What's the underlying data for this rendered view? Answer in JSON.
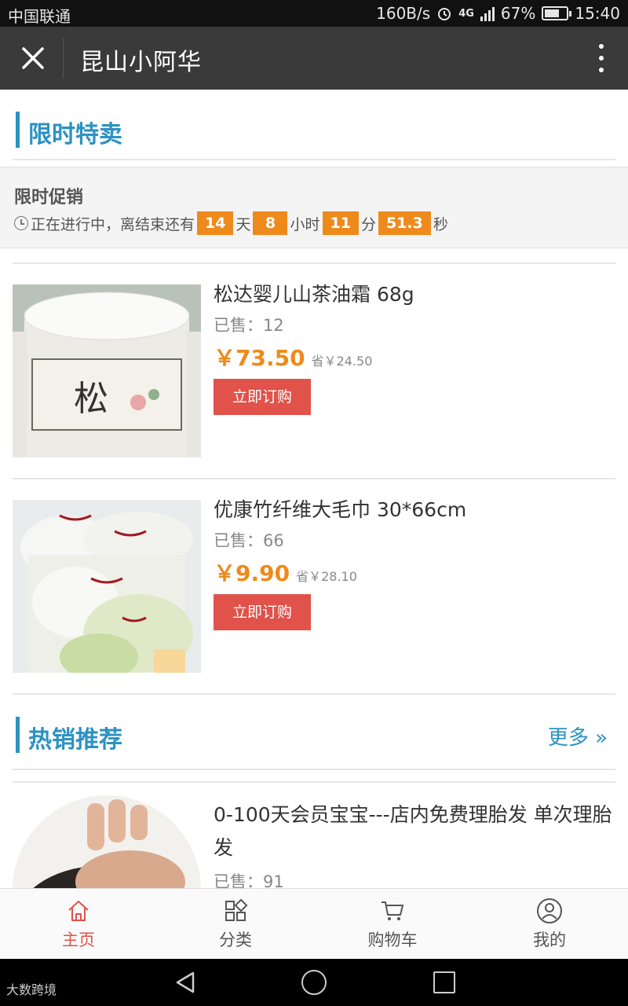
{
  "status_bar": {
    "carrier": "中国联通",
    "speed": "160B/s",
    "network": "4G",
    "battery": "67%",
    "battery_level": 0.67,
    "time": "15:40"
  },
  "title_bar": {
    "title": "昆山小阿华"
  },
  "flash_sale": {
    "section_title": "限时特卖",
    "promo_title": "限时促销",
    "countdown_prefix": "正在进行中，离结束还有",
    "days": "14",
    "days_unit": "天",
    "hours": "8",
    "hours_unit": "小时",
    "minutes": "11",
    "minutes_unit": "分",
    "seconds": "51.3",
    "seconds_unit": "秒"
  },
  "products": [
    {
      "name": "松达婴儿山茶油霜 68g",
      "sold": "已售：12",
      "price": "￥73.50",
      "save": "省￥24.50",
      "button": "立即订购"
    },
    {
      "name": "优康竹纤维大毛巾 30*66cm",
      "sold": "已售：66",
      "price": "￥9.90",
      "save": "省￥28.10",
      "button": "立即订购"
    }
  ],
  "hot": {
    "section_title": "热销推荐",
    "more": "更多 »",
    "items": [
      {
        "name": "0-100天会员宝宝---店内免费理胎发 单次理胎发",
        "sold": "已售：91"
      }
    ]
  },
  "bottom_nav": [
    {
      "label": "主页",
      "icon": "home-icon",
      "active": true
    },
    {
      "label": "分类",
      "icon": "category-icon",
      "active": false
    },
    {
      "label": "购物车",
      "icon": "cart-icon",
      "active": false
    },
    {
      "label": "我的",
      "icon": "user-icon",
      "active": false
    }
  ],
  "watermark": "大数跨境",
  "colors": {
    "accent_blue": "#2b92c2",
    "price_orange": "#ee8a1c",
    "button_red": "#e0524a",
    "titlebar": "#3a3a3a"
  }
}
